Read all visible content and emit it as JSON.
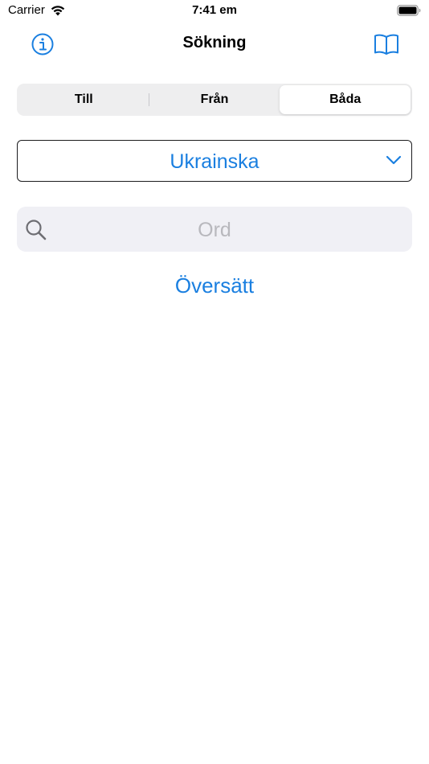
{
  "status_bar": {
    "carrier": "Carrier",
    "time": "7:41 em"
  },
  "nav": {
    "title": "Sökning",
    "left_icon": "info-icon",
    "right_icon": "book-icon"
  },
  "segmented": {
    "segments": [
      "Till",
      "Från",
      "Båda"
    ],
    "selected": "Båda"
  },
  "language_picker": {
    "value": "Ukrainska",
    "icon": "chevron-down-icon"
  },
  "search": {
    "placeholder": "Ord",
    "value": "",
    "icon": "search-icon"
  },
  "translate_button": {
    "label": "Översätt"
  },
  "colors": {
    "accent": "#1a7fe0",
    "segment_bg": "#eeeeef",
    "search_bg": "#f0f0f5",
    "placeholder": "#b8b8bd"
  }
}
